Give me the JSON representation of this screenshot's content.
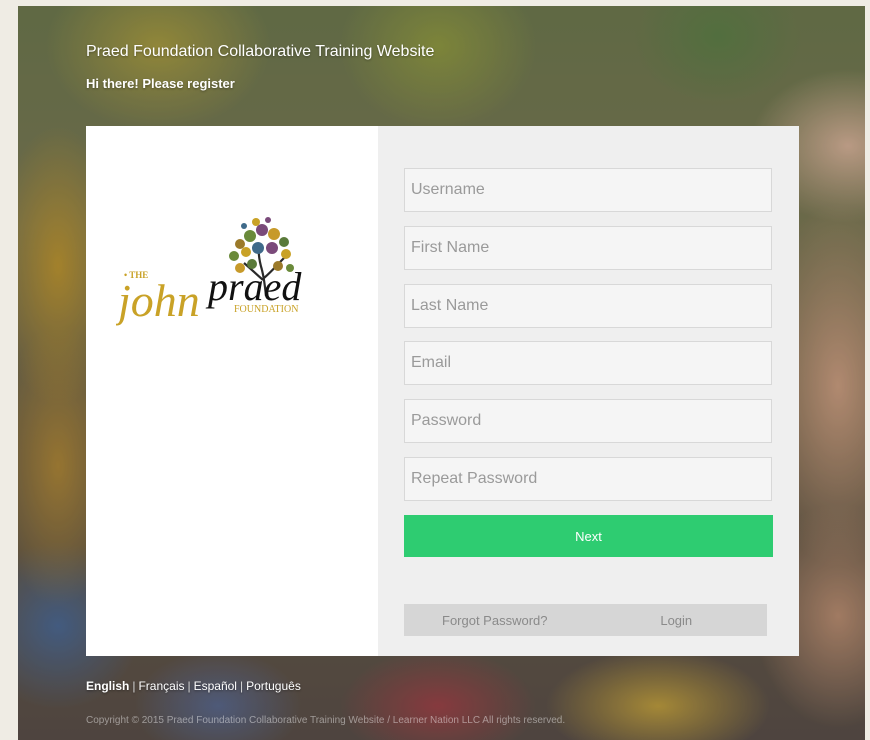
{
  "header": {
    "site_title": "Praed Foundation Collaborative Training Website",
    "greeting": "Hi there! Please register"
  },
  "logo": {
    "prefix": "• THE",
    "name_part1": "john",
    "name_part2": "praed",
    "suffix": "FOUNDATION"
  },
  "form": {
    "username_placeholder": "Username",
    "firstname_placeholder": "First Name",
    "lastname_placeholder": "Last Name",
    "email_placeholder": "Email",
    "password_placeholder": "Password",
    "repeat_password_placeholder": "Repeat Password",
    "next_label": "Next",
    "forgot_password_label": "Forgot Password?",
    "login_label": "Login"
  },
  "languages": [
    "English",
    "Français",
    "Español",
    "Português"
  ],
  "language_separator": "|",
  "footer": {
    "copyright": "Copyright © 2015 Praed Foundation Collaborative Training Website / Learner Nation LLC All rights reserved."
  },
  "colors": {
    "accent_green": "#2ecc71",
    "logo_gold": "#c9a227",
    "logo_black": "#111111"
  }
}
